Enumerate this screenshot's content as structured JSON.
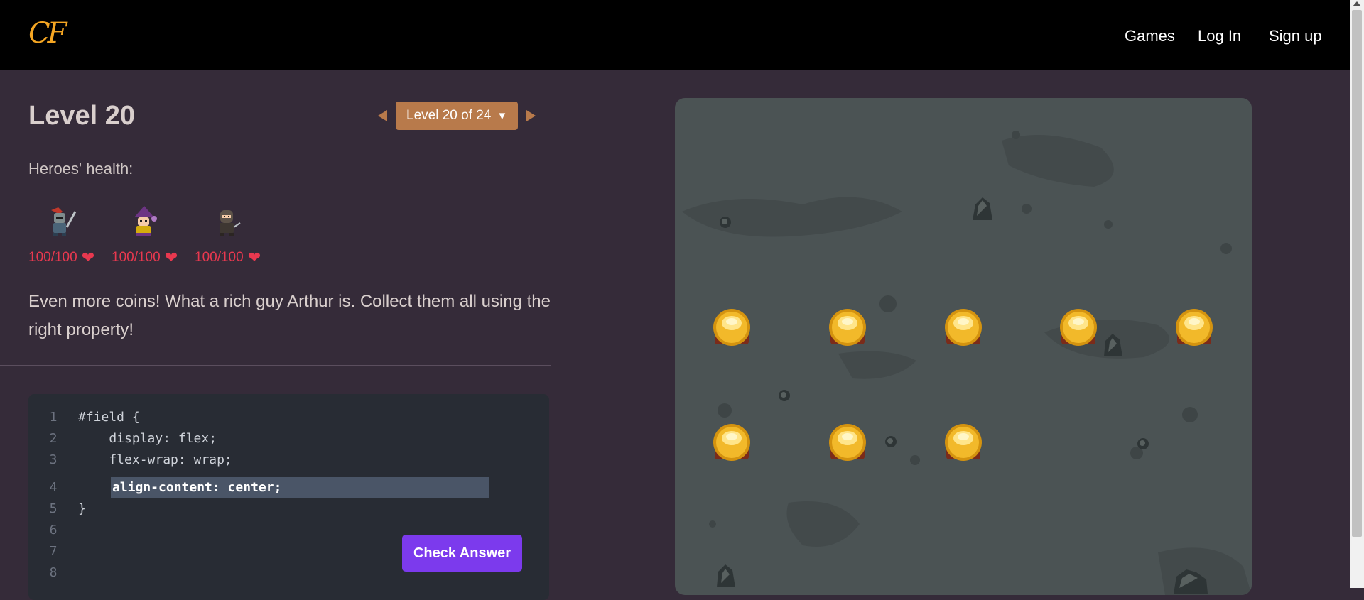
{
  "header": {
    "logo": "CF",
    "nav": [
      "Games",
      "Log In",
      "Sign up"
    ]
  },
  "level": {
    "title": "Level 20",
    "selector": "Level 20 of 24"
  },
  "health": {
    "label": "Heroes' health:",
    "heroes": [
      {
        "name": "knight",
        "hp": "100/100"
      },
      {
        "name": "wizard",
        "hp": "100/100"
      },
      {
        "name": "rogue",
        "hp": "100/100"
      }
    ]
  },
  "description": "Even more coins! What a rich guy Arthur is. Collect them all using the right property!",
  "editor": {
    "lines": [
      {
        "num": "1",
        "code": "#field {"
      },
      {
        "num": "2",
        "code": "    display: flex;"
      },
      {
        "num": "3",
        "code": "    flex-wrap: wrap;"
      },
      {
        "num": "4",
        "code": "align-content: center;"
      },
      {
        "num": "5",
        "code": "}"
      },
      {
        "num": "6",
        "code": ""
      },
      {
        "num": "7",
        "code": ""
      },
      {
        "num": "8",
        "code": ""
      }
    ],
    "check_button": "Check Answer"
  },
  "colors": {
    "accent": "#b87a4b",
    "button": "#7c3aed",
    "heart": "#e8384f",
    "background": "#352b39",
    "board": "#4b5354"
  },
  "board": {
    "coins_row1": 5,
    "coins_row2": 3
  }
}
